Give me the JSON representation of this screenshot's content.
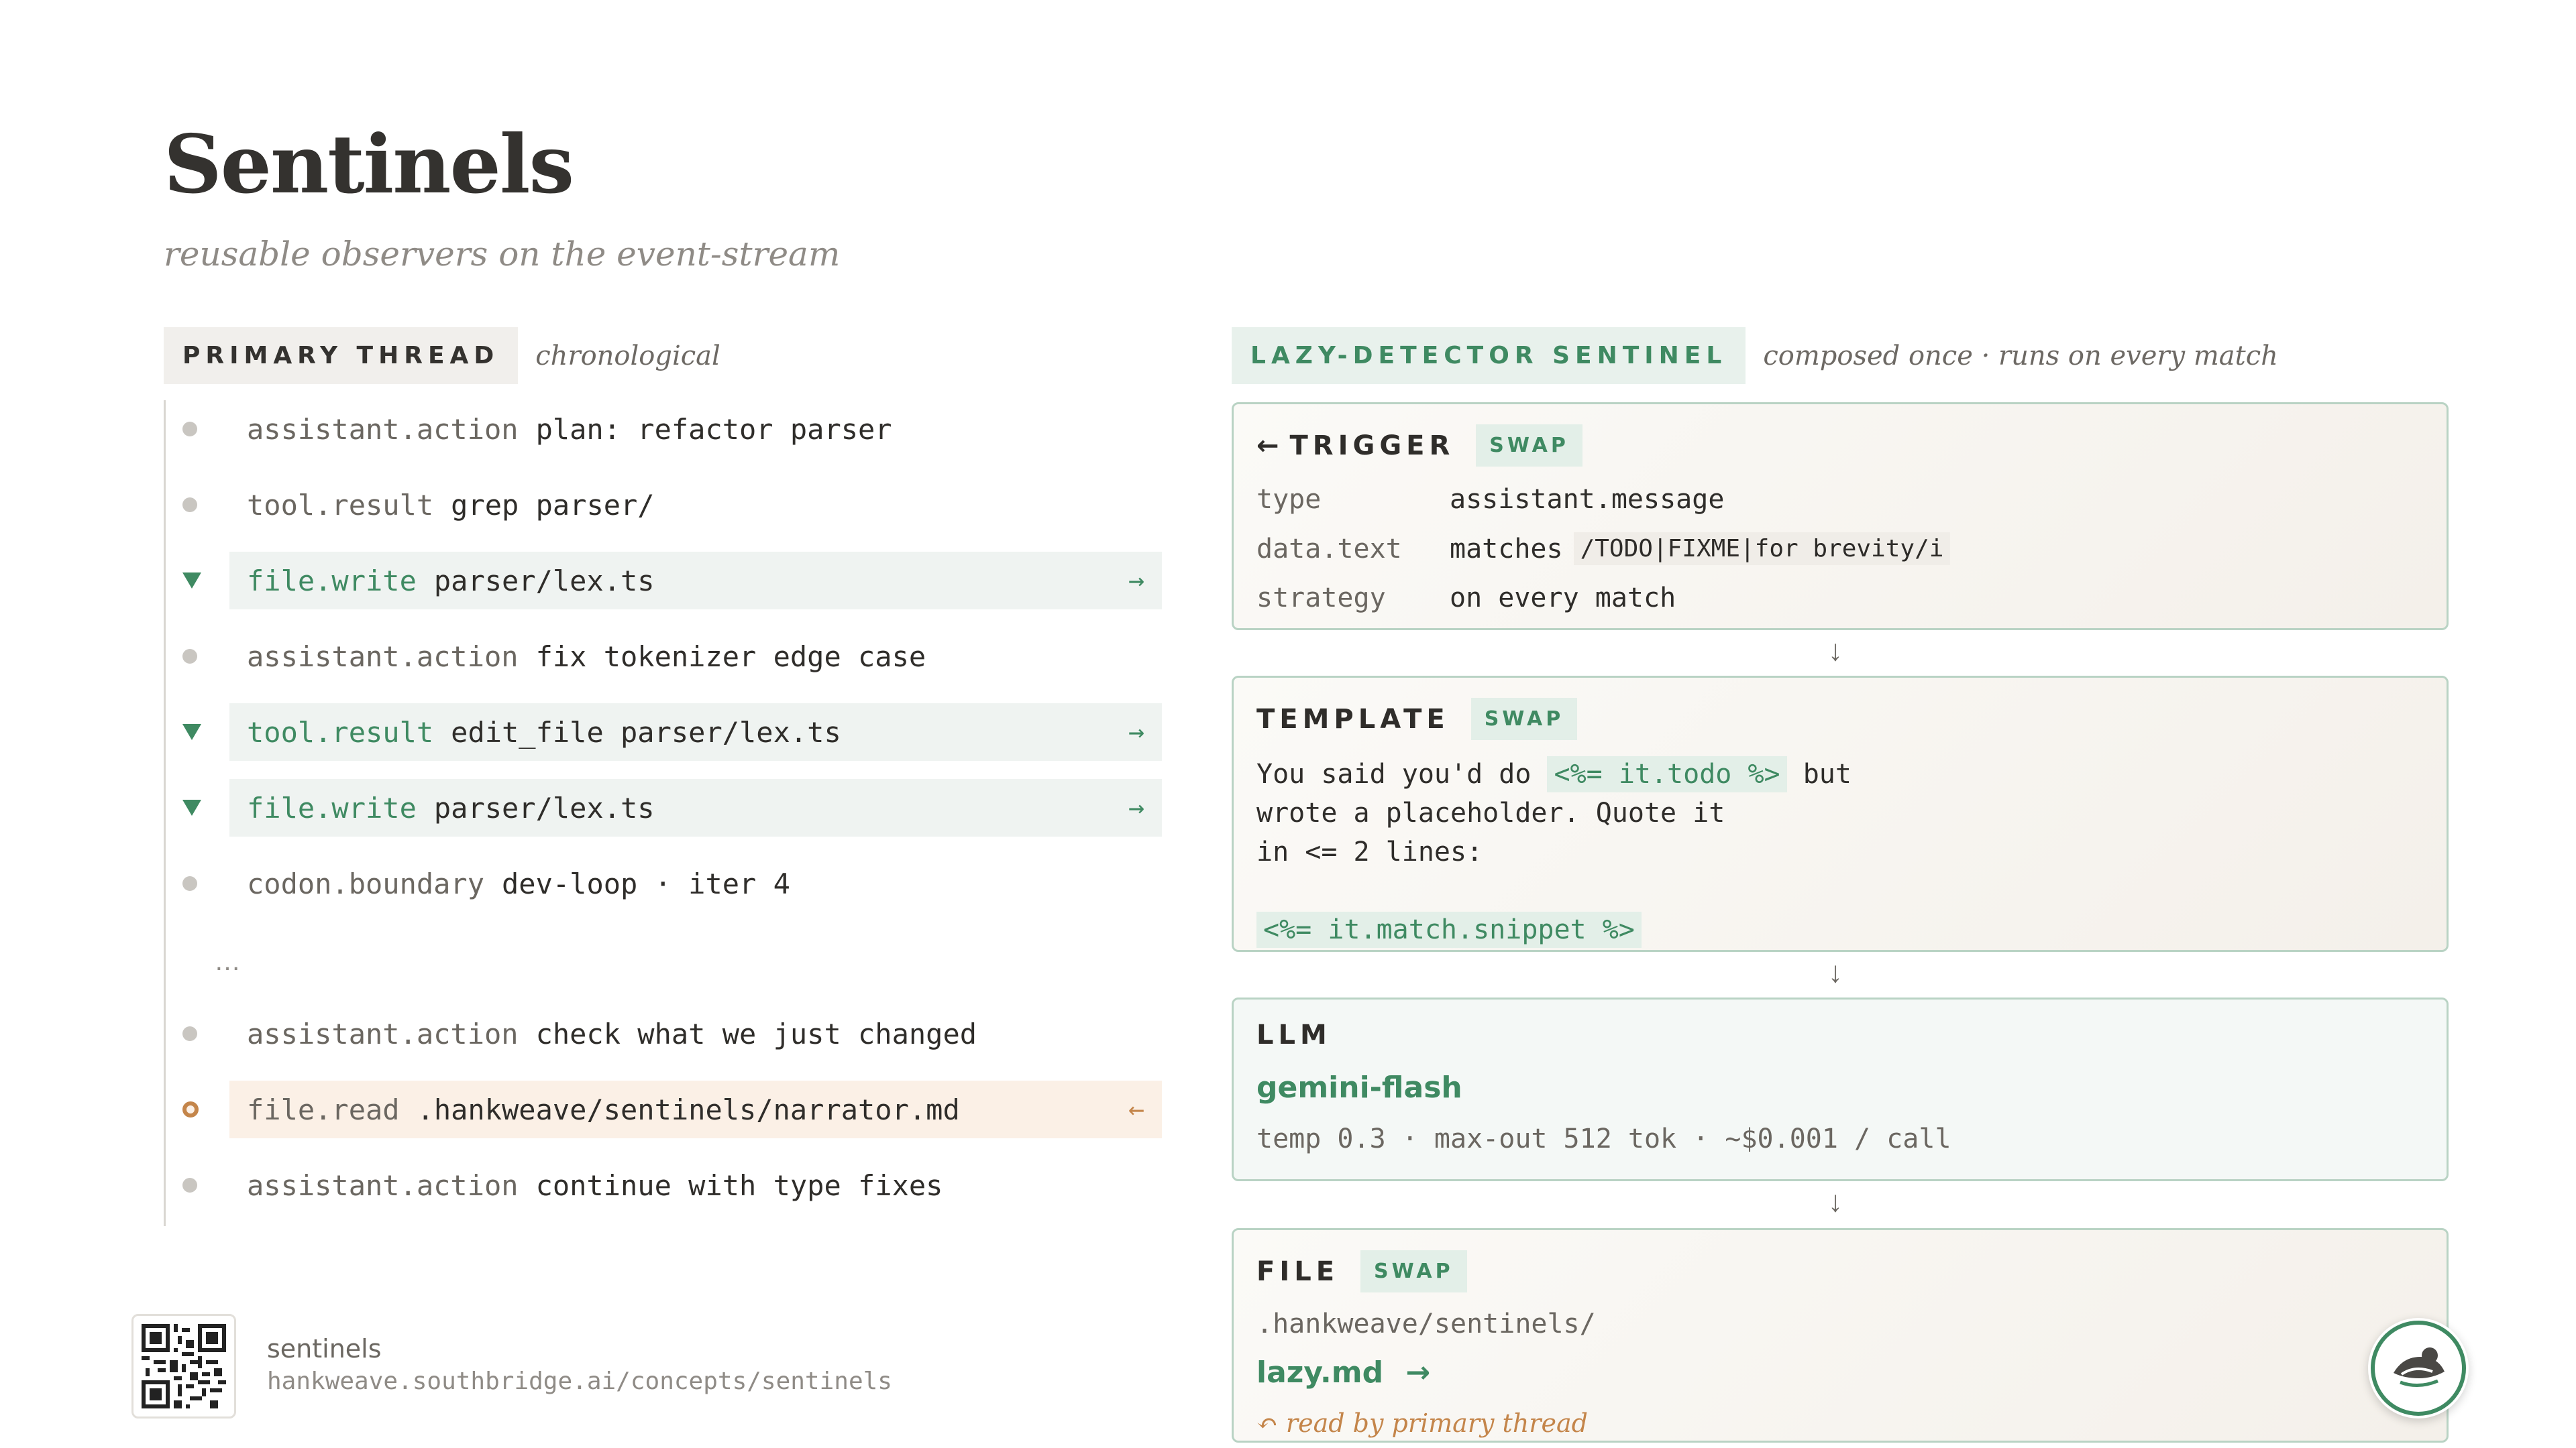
{
  "header": {
    "title": "Sentinels",
    "subtitle": "reusable observers on the event-stream"
  },
  "primary_thread": {
    "tag": "PRIMARY THREAD",
    "note": "chronological",
    "ellipsis": "…",
    "rows": [
      {
        "event": "assistant.action",
        "detail": "plan: refactor parser"
      },
      {
        "event": "tool.result",
        "detail": "grep parser/"
      },
      {
        "event": "file.write",
        "detail": "parser/lex.ts",
        "arrow": "→"
      },
      {
        "event": "assistant.action",
        "detail": "fix tokenizer edge case"
      },
      {
        "event": "tool.result",
        "detail": "edit_file parser/lex.ts",
        "arrow": "→"
      },
      {
        "event": "file.write",
        "detail": "parser/lex.ts",
        "arrow": "→"
      },
      {
        "event": "codon.boundary",
        "detail": "dev-loop · iter 4"
      },
      {
        "event": "assistant.action",
        "detail": "check what we just changed"
      },
      {
        "event": "file.read",
        "detail": ".hankweave/sentinels/narrator.md",
        "arrow": "←"
      },
      {
        "event": "assistant.action",
        "detail": "continue with type fixes"
      }
    ]
  },
  "sentinel": {
    "tag": "LAZY-DETECTOR SENTINEL",
    "note": "composed once · runs on every match",
    "down_arrow": "↓",
    "swap_label": "SWAP",
    "trigger": {
      "title_arrow": "←",
      "title": "TRIGGER",
      "rows": [
        {
          "key": "type",
          "value": "assistant.message"
        },
        {
          "key": "data.text",
          "value": "matches",
          "code": "/TODO|FIXME|for brevity/i"
        },
        {
          "key": "strategy",
          "value": "on every match"
        }
      ]
    },
    "template": {
      "title": "TEMPLATE",
      "line1_a": "You said you'd do ",
      "line1_code": "<%= it.todo %>",
      "line1_b": " but",
      "line2": "wrote a placeholder. Quote it",
      "line3": "in <= 2 lines:",
      "line4_code": "<%= it.match.snippet %>"
    },
    "llm": {
      "title": "LLM",
      "model": "gemini-flash",
      "meta": "temp 0.3 · max-out 512 tok · ~$0.001 / call"
    },
    "file": {
      "title": "FILE",
      "path": ".hankweave/sentinels/",
      "name": "lazy.md",
      "name_arrow": "→",
      "read_by": "↶ read by primary thread"
    }
  },
  "footer": {
    "name": "sentinels",
    "url": "hankweave.southbridge.ai/concepts/sentinels"
  },
  "colors": {
    "accent": "#3f8a62",
    "warm": "#c4854a",
    "text": "#2f2d2a"
  },
  "icons": [
    "qr-code-icon",
    "hankweave-logo-icon",
    "dot-icon",
    "triangle-icon",
    "ring-icon"
  ]
}
